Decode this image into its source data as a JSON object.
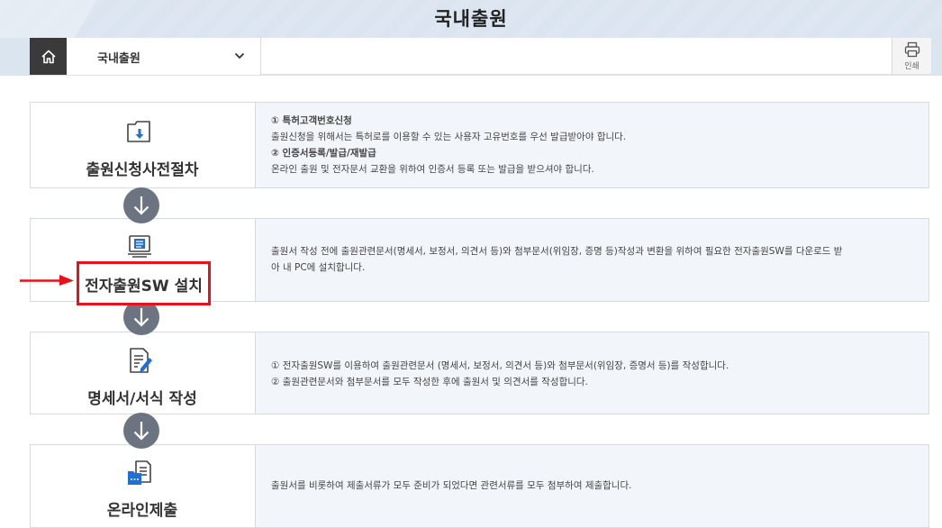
{
  "banner": {
    "title": "국내출원"
  },
  "navbar": {
    "home_icon": "home-icon",
    "menu_selected": "국내출원",
    "print_label": "인쇄"
  },
  "steps": [
    {
      "title": "출원신청사전절차",
      "icon": "folder-download-icon",
      "lines": [
        {
          "text": "① 특허고객번호신청",
          "bold": true
        },
        {
          "text": "출원신청을 위해서는 특허로를 이용할 수 있는 사용자 고유번호를 우선 발급받아야 합니다.",
          "bold": false
        },
        {
          "text": "② 인증서등록/발급/재발급",
          "bold": true
        },
        {
          "text": "온라인 출원 및 전자문서 교환을 위하여 인증서 등록 또는 발급을 받으셔야 합니다.",
          "bold": false
        }
      ]
    },
    {
      "title": "전자출원SW 설치",
      "icon": "computer-install-icon",
      "highlighted": true,
      "lines": [
        {
          "text": "출원서 작성 전에 출원관련문서(명세서, 보정서, 의견서 등)와 첨부문서(위임장, 증명 등)작성과 변환을 위하여 필요한 전자출원SW를 다운로드 받",
          "bold": false
        },
        {
          "text": "아 내 PC에 설치합니다.",
          "bold": false
        }
      ]
    },
    {
      "title": "명세서/서식 작성",
      "icon": "document-edit-icon",
      "lines": [
        {
          "text": "① 전자출원SW를 이용하여 출원관련문서 (명세서, 보정서, 의견서 등)와 첨부문서(위임장, 증명서 등)를 작성합니다.",
          "bold": false
        },
        {
          "text": "② 출원관련문서와 첨부문서를 모두 작성한 후에 출원서 및 의견서를 작성합니다.",
          "bold": false
        }
      ]
    },
    {
      "title": "온라인제출",
      "icon": "folder-document-icon",
      "lines": [
        {
          "text": "출원서를 비롯하여 제출서류가 모두 준비가 되었다면 관련서류를 모두 첨부하여 제출합니다.",
          "bold": false
        }
      ]
    }
  ],
  "colors": {
    "banner_bg": "#dbe5f0",
    "highlight": "#e8101a",
    "arrow_circle": "#6b7480",
    "desc_bg": "#f2f6fb",
    "icon_blue": "#1f6fd6"
  }
}
